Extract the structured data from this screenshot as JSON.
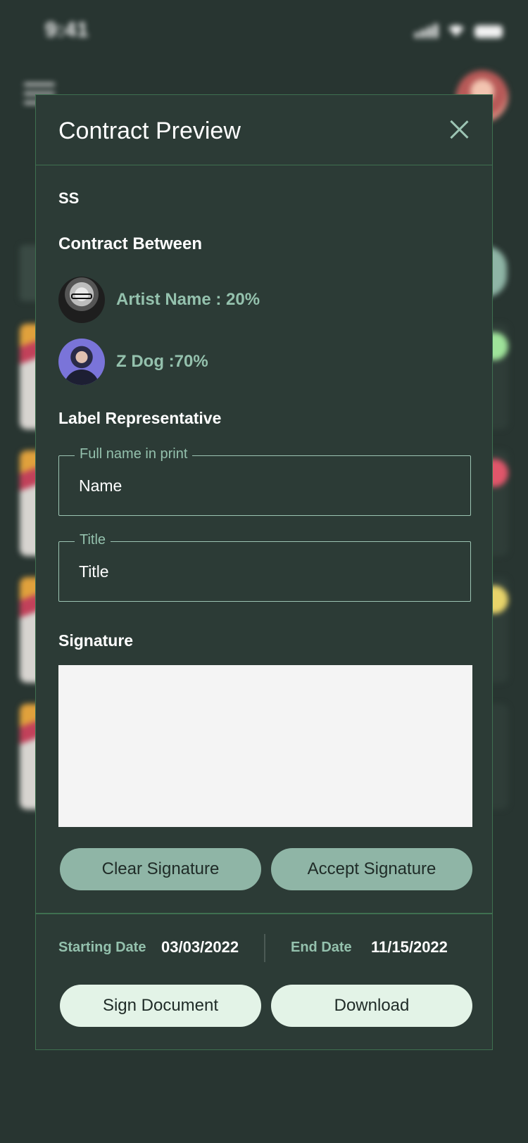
{
  "status_bar": {
    "time": "9:41"
  },
  "modal": {
    "title": "Contract Preview",
    "subtitle": "SS",
    "contract_between_heading": "Contract Between",
    "parties": [
      {
        "label": "Artist Name : 20%"
      },
      {
        "label": "Z Dog :70%"
      }
    ],
    "label_rep_heading": "Label Representative",
    "fields": {
      "full_name": {
        "legend": "Full name in print",
        "placeholder": "Name"
      },
      "title": {
        "legend": "Title",
        "placeholder": "Title"
      }
    },
    "signature_heading": "Signature",
    "buttons": {
      "clear_signature": "Clear Signature",
      "accept_signature": "Accept Signature",
      "sign_document": "Sign Document",
      "download": "Download"
    },
    "dates": {
      "start_label": "Starting Date",
      "start_value": "03/03/2022",
      "end_label": "End Date",
      "end_value": "11/15/2022"
    }
  },
  "colors": {
    "background": "#283531",
    "modal_bg": "#2c3b36",
    "accent_green": "#94c1ad",
    "button_mid": "#8fb5a6",
    "button_light": "#e3f3e7",
    "border": "#3f7050"
  },
  "icons": {
    "close": "close-icon",
    "menu": "menu-icon",
    "signal": "signal-icon",
    "wifi": "wifi-icon",
    "battery": "battery-icon"
  }
}
